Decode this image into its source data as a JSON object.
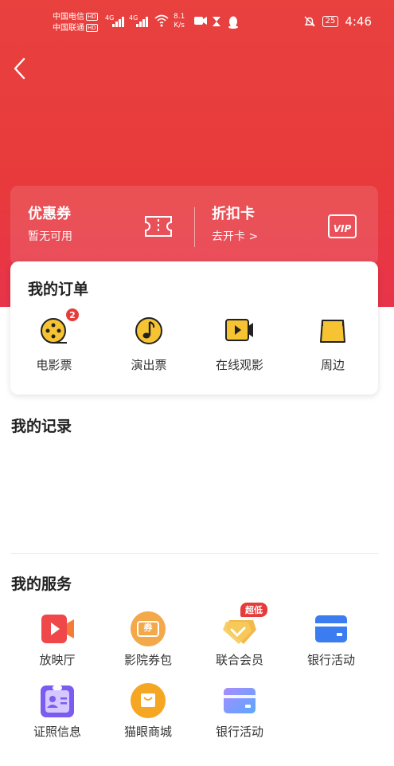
{
  "status_bar": {
    "carrier_1": "中国电信",
    "carrier_2": "中国联通",
    "hd": "HD",
    "net_1": "4G",
    "net_2": "4G",
    "speed_value": "8.1",
    "speed_unit": "K/s",
    "battery": "25",
    "time": "4:46"
  },
  "coupon_strip": {
    "coupon_title": "优惠券",
    "coupon_sub": "暂无可用",
    "card_title": "折扣卡",
    "card_sub": "去开卡 >",
    "vip_text": "VIP"
  },
  "orders": {
    "title": "我的订单",
    "items": [
      {
        "label": "电影票",
        "icon": "film-reel-icon",
        "badge": "2"
      },
      {
        "label": "演出票",
        "icon": "music-note-icon"
      },
      {
        "label": "在线观影",
        "icon": "video-camera-icon"
      },
      {
        "label": "周边",
        "icon": "shopping-bag-icon"
      }
    ]
  },
  "records": {
    "title": "我的记录"
  },
  "services": {
    "title": "我的服务",
    "items": [
      {
        "label": "放映厅",
        "icon": "video-play-icon"
      },
      {
        "label": "影院券包",
        "icon": "coupon-icon",
        "icon_text": "券"
      },
      {
        "label": "联合会员",
        "icon": "membership-tag-icon",
        "tag": "超低"
      },
      {
        "label": "银行活动",
        "icon": "bank-card-icon"
      },
      {
        "label": "证照信息",
        "icon": "id-card-icon"
      },
      {
        "label": "猫眼商城",
        "icon": "store-bag-icon"
      },
      {
        "label": "银行活动",
        "icon": "bank-card-gradient-icon"
      }
    ]
  },
  "colors": {
    "brand_red": "#e8413e",
    "badge_red": "#e63b3b",
    "icon_yellow": "#f6c332"
  }
}
